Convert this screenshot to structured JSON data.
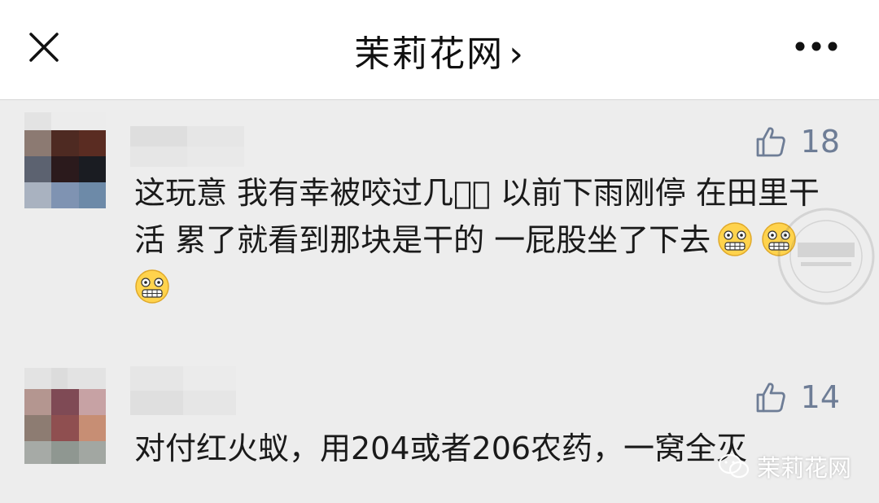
{
  "header": {
    "title": "茉莉花网",
    "chevron": "›",
    "close_icon": "close-icon",
    "more_icon": "more-icon"
  },
  "comments": [
    {
      "likes": "18",
      "text": "这玩意 我有幸被咬过几次ͦ 以前下雨刚停 在田里干活 累了就看到那块是干的 一屁股坐了下去",
      "emojis": [
        "grimace-emoji",
        "grimace-emoji",
        "grimace-emoji"
      ]
    },
    {
      "likes": "14",
      "text": "对付红火蚁，用204或者206农药，一窝全灭"
    }
  ],
  "watermark": {
    "label": "茉莉花网",
    "icon": "wechat-icon"
  },
  "colors": {
    "background": "#ededed",
    "header_bg": "#ffffff",
    "like_color": "#6e7d96",
    "text_color": "#1a1a1a"
  }
}
